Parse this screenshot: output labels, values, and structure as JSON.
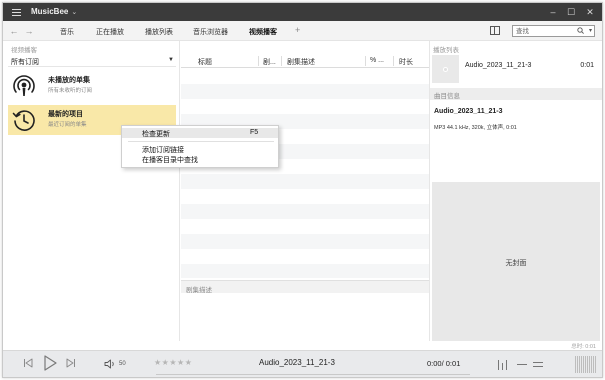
{
  "app": {
    "title": "MusicBee",
    "title_caret": "⌄"
  },
  "window_controls": {
    "minimize": "–",
    "maximize": "☐",
    "close": "✕"
  },
  "nav": {
    "back": "←",
    "forward": "→",
    "tabs": [
      "音乐",
      "正在播放",
      "播放列表",
      "音乐浏览器",
      "视频播客"
    ],
    "active_tab": "视频播客",
    "add_tab": "+"
  },
  "search": {
    "placeholder": "查找",
    "icon": "search-icon",
    "caret": "▾"
  },
  "left_panel": {
    "header": "视频播客",
    "filter_label": "所有订阅",
    "filter_arrow": "▼",
    "items": [
      {
        "title": "未播放的单集",
        "desc": "所有未收听的订阅",
        "icon": "podcast-icon",
        "selected": false
      },
      {
        "title": "最新的项目",
        "desc": "最近订阅的单集",
        "icon": "history-clock-icon",
        "selected": true
      }
    ]
  },
  "center_panel": {
    "columns": [
      "标题",
      "剧...",
      "剧集描述",
      "% ...",
      "时长"
    ],
    "episode_header": "剧集描述"
  },
  "context_menu": {
    "items": [
      {
        "label": "检查更新",
        "shortcut": "F5"
      },
      {
        "label": "添加订阅链接",
        "shortcut": ""
      },
      {
        "label": "在播客目录中查找",
        "shortcut": ""
      }
    ]
  },
  "right_panel": {
    "queue_header": "播放列表",
    "queue_item": {
      "title": "Audio_2023_11_21-3",
      "time": "0:01"
    },
    "track_info_header": "曲目信息",
    "track_title": "Audio_2023_11_21-3",
    "track_details": "MP3 44.1 kHz, 320k, 立体声, 0:01",
    "artwork_text": "无封面"
  },
  "status": {
    "total": "总时: 0:01"
  },
  "player": {
    "prev": "◁",
    "play": "▷",
    "next": "▷",
    "volume_icon": "◁)",
    "volume": "50",
    "rating": "★★★★★",
    "rating_value": 0,
    "now_playing": "Audio_2023_11_21-3",
    "time": "0:00/ 0:01",
    "progress": 0.0
  },
  "colors": {
    "titlebar": "#3b3b3b",
    "selection": "#f9e8a8",
    "artwork_bg": "#e8e8e8",
    "player_bg": "#e9eaec"
  }
}
